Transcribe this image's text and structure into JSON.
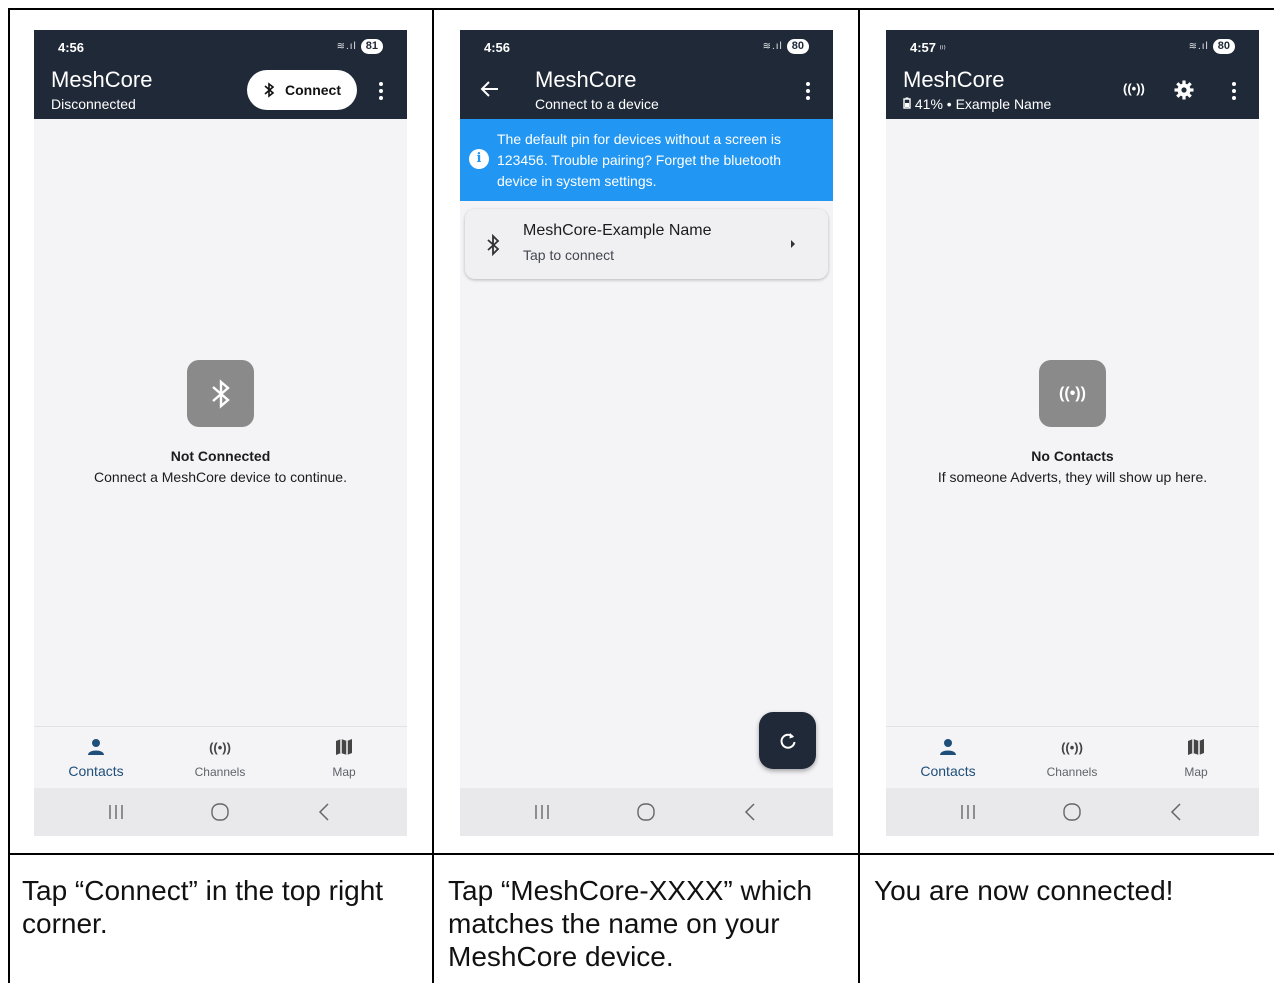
{
  "colors": {
    "appbar": "#1f2937",
    "banner": "#2196f3",
    "active_nav": "#1f4e79"
  },
  "panel1": {
    "status_time": "4:56",
    "battery": "81",
    "title": "MeshCore",
    "subtitle": "Disconnected",
    "connect_label": "Connect",
    "empty_title": "Not Connected",
    "empty_desc": "Connect a MeshCore device to continue.",
    "nav": {
      "contacts": "Contacts",
      "channels": "Channels",
      "map": "Map"
    },
    "caption": "Tap “Connect” in the top right corner."
  },
  "panel2": {
    "status_time": "4:56",
    "battery": "80",
    "title": "MeshCore",
    "subtitle": "Connect to a device",
    "banner": "The default pin for devices without a screen is 123456. Trouble pairing? Forget the bluetooth device in system settings.",
    "device_name": "MeshCore-Example Name",
    "device_sub": "Tap to connect",
    "caption": "Tap “MeshCore-XXXX” which matches the name on your MeshCore device."
  },
  "panel3": {
    "status_time": "4:57",
    "status_extra": "⁽ⁱ⁾",
    "battery": "80",
    "title": "MeshCore",
    "subtitle": "41% • Example Name",
    "empty_title": "No Contacts",
    "empty_desc": "If someone Adverts, they will show up here.",
    "nav": {
      "contacts": "Contacts",
      "channels": "Channels",
      "map": "Map"
    },
    "caption": "You are now connected!"
  }
}
